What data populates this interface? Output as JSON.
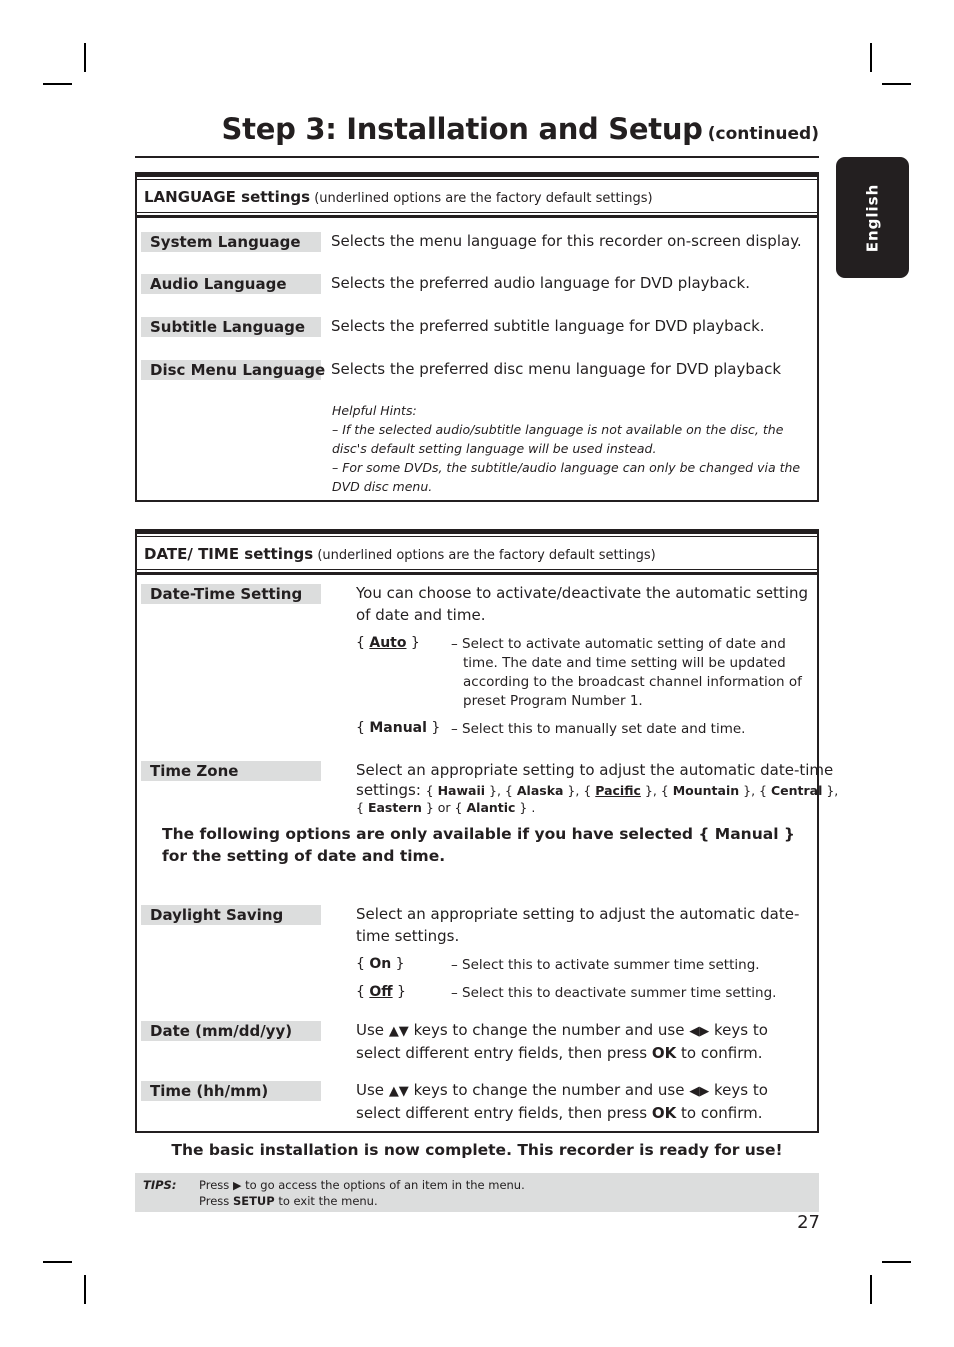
{
  "page": {
    "title": "Step 3: Installation and Setup",
    "title_suffix": "(continued)",
    "side_tab": "English",
    "page_number": "27"
  },
  "language_settings": {
    "heading_bold": "LANGUAGE settings",
    "heading_note": "(underlined options are the factory default settings)",
    "items": [
      {
        "label": "System Language",
        "description": "Selects the menu language for this recorder on-screen display."
      },
      {
        "label": "Audio Language",
        "description": "Selects the preferred audio language for DVD playback."
      },
      {
        "label": "Subtitle Language",
        "description": "Selects the preferred subtitle language for DVD playback."
      },
      {
        "label": "Disc Menu Language",
        "description": "Selects the preferred disc menu language for DVD playback"
      }
    ],
    "hints": {
      "title": "Helpful Hints:",
      "lines": [
        "–  If the selected audio/subtitle language is not available on the disc, the disc's default setting language will be used instead.",
        "–  For some DVDs, the subtitle/audio language can only be changed via the DVD disc menu."
      ]
    }
  },
  "datetime_settings": {
    "heading_bold": "DATE/ TIME settings",
    "heading_note": "(underlined options are the factory default settings)",
    "date_time_setting": {
      "label": "Date-Time Setting",
      "description": "You can choose to activate/deactivate the automatic setting of date and time.",
      "options": [
        {
          "key": "Auto",
          "default": true,
          "description": "– Select to activate automatic setting of date and time. The date and time setting will be updated according to the broadcast channel information of preset Program Number 1."
        },
        {
          "key": "Manual",
          "default": false,
          "description": "– Select this to manually set date and time."
        }
      ]
    },
    "time_zone": {
      "label": "Time Zone",
      "description": "Select an appropriate setting to adjust the automatic date-time",
      "settings_prefix": "settings:",
      "options": [
        {
          "key": "Hawaii",
          "default": false
        },
        {
          "key": "Alaska",
          "default": false
        },
        {
          "key": "Pacific",
          "default": true
        },
        {
          "key": "Mountain",
          "default": false
        },
        {
          "key": "Central",
          "default": false
        },
        {
          "key": "Eastern",
          "default": false
        },
        {
          "key": "Alantic",
          "default": false
        }
      ],
      "joiner_or": "or"
    },
    "manual_notice": "The following options are only available if you have selected { Manual } for the setting of date and time.",
    "daylight_saving": {
      "label": "Daylight Saving",
      "description": "Select an appropriate setting to adjust the automatic date-time settings.",
      "options": [
        {
          "key": "On",
          "default": false,
          "description": "– Select this to activate summer time setting."
        },
        {
          "key": "Off",
          "default": true,
          "description": "– Select this to deactivate summer time setting."
        }
      ]
    },
    "date": {
      "label": "Date (mm/dd/yy)",
      "desc_use": "Use",
      "desc_updown": "▲▼",
      "desc_mid": "keys to change the number and use",
      "desc_leftright": "◀▶",
      "desc_keys_to": "keys to",
      "desc_line2_a": "select different entry fields, then press",
      "desc_ok": "OK",
      "desc_line2_b": "to confirm."
    },
    "time": {
      "label": "Time (hh/mm)",
      "desc_use": "Use",
      "desc_updown": "▲▼",
      "desc_mid": "keys to change the number and use",
      "desc_leftright": "◀▶",
      "desc_keys_to": "keys to",
      "desc_line2_a": "select different entry fields, then press",
      "desc_ok": "OK",
      "desc_line2_b": "to confirm."
    }
  },
  "completion_message": "The basic installation is now complete. This recorder is ready for use!",
  "tips": {
    "label": "TIPS:",
    "line1_a": "Press",
    "line1_icon": "▶",
    "line1_b": "to go access the options of an item in the menu.",
    "line2_a": "Press",
    "line2_key": "SETUP",
    "line2_b": "to exit the menu."
  }
}
